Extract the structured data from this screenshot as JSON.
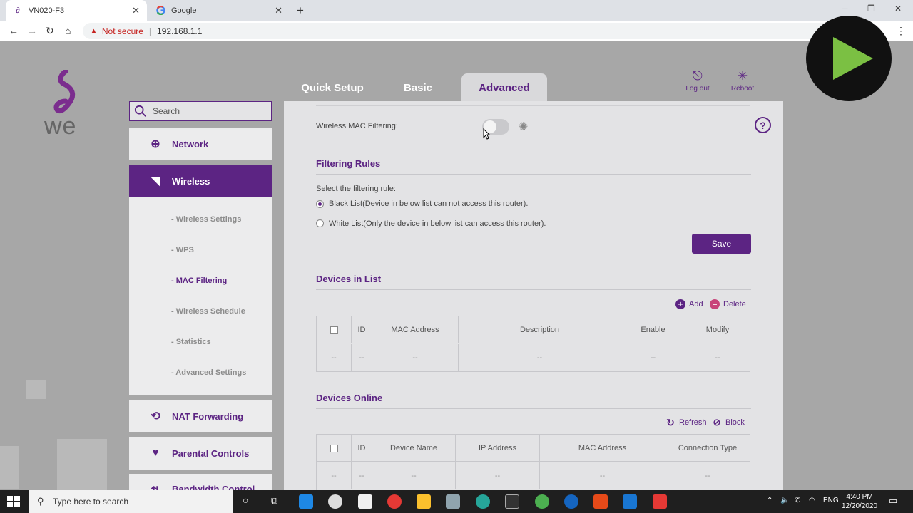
{
  "browser": {
    "tabs": [
      {
        "title": "VN020-F3",
        "active": true
      },
      {
        "title": "Google",
        "active": false
      }
    ],
    "security_label": "Not secure",
    "url": "192.168.1.1"
  },
  "router": {
    "top_tabs": [
      "Quick Setup",
      "Basic",
      "Advanced"
    ],
    "tools": {
      "logout": "Log out",
      "reboot": "Reboot"
    },
    "search_placeholder": "Search",
    "sidebar": {
      "network": "Network",
      "wireless": "Wireless",
      "sub_items": [
        "- Wireless Settings",
        "- WPS",
        "- MAC Filtering",
        "- Wireless Schedule",
        "- Statistics",
        "- Advanced Settings"
      ],
      "nat": "NAT Forwarding",
      "parental": "Parental Controls",
      "bandwidth": "Bandwidth Control"
    },
    "mac_filter_label": "Wireless MAC Filtering:",
    "filtering_rules": {
      "title": "Filtering Rules",
      "select_label": "Select the filtering rule:",
      "black_list": "Black List(Device in below list can not access this router).",
      "white_list": "White List(Only the device in below list can access this router).",
      "save": "Save"
    },
    "devices_in_list": {
      "title": "Devices in List",
      "add": "Add",
      "delete": "Delete",
      "headers": [
        "ID",
        "MAC Address",
        "Description",
        "Enable",
        "Modify"
      ],
      "empty": "--"
    },
    "devices_online": {
      "title": "Devices Online",
      "refresh": "Refresh",
      "block": "Block",
      "headers": [
        "ID",
        "Device Name",
        "IP Address",
        "MAC Address",
        "Connection Type"
      ],
      "empty": "--"
    }
  },
  "taskbar": {
    "search_placeholder": "Type here to search",
    "lang": "ENG",
    "time": "4:40 PM",
    "date": "12/20/2020"
  },
  "colors": {
    "brand": "#5c2483",
    "background": "#a7a7a7",
    "panel": "#e3e3e5"
  }
}
